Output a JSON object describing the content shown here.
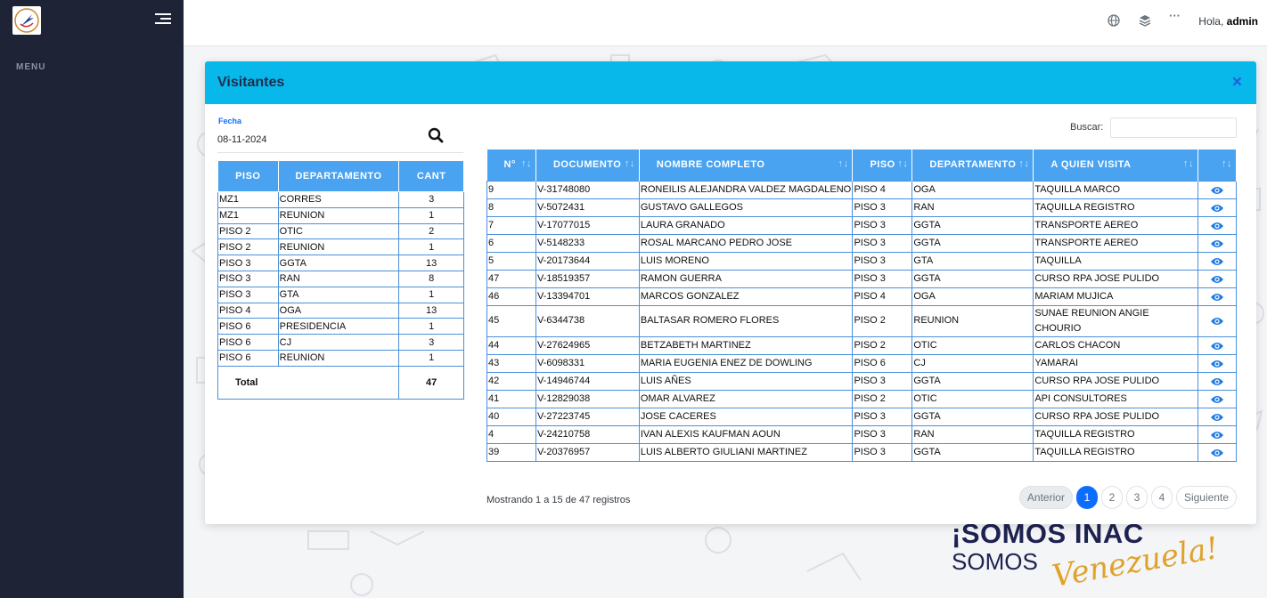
{
  "sidebar": {
    "menu_label": "MENU"
  },
  "topbar": {
    "greeting": "Hola,",
    "user": "admin",
    "icons": [
      "globe-icon",
      "layers-icon",
      "more-icon"
    ]
  },
  "brand": {
    "line1": "¡SOMOS INAC",
    "line2": "SOMOS",
    "script": "Venezuela!"
  },
  "modal": {
    "title": "Visitantes",
    "close_label": "×",
    "date_label": "Fecha",
    "date_value": "08-11-2024",
    "summary": {
      "headers": [
        "PISO",
        "DEPARTAMENTO",
        "CANT"
      ],
      "rows": [
        [
          "MZ1",
          "CORRES",
          "3"
        ],
        [
          "MZ1",
          "REUNION",
          "1"
        ],
        [
          "PISO 2",
          "OTIC",
          "2"
        ],
        [
          "PISO 2",
          "REUNION",
          "1"
        ],
        [
          "PISO 3",
          "GGTA",
          "13"
        ],
        [
          "PISO 3",
          "RAN",
          "8"
        ],
        [
          "PISO 3",
          "GTA",
          "1"
        ],
        [
          "PISO 4",
          "OGA",
          "13"
        ],
        [
          "PISO 6",
          "PRESIDENCIA",
          "1"
        ],
        [
          "PISO 6",
          "CJ",
          "3"
        ],
        [
          "PISO 6",
          "REUNION",
          "1"
        ]
      ],
      "total_label": "Total",
      "total_value": "47"
    },
    "search_label": "Buscar:",
    "search_value": "",
    "visitors": {
      "headers": [
        "N°",
        "DOCUMENTO",
        "NOMBRE COMPLETO",
        "PISO",
        "DEPARTAMENTO",
        "A QUIEN VISITA",
        ""
      ],
      "rows": [
        [
          "9",
          "V-31748080",
          "RONEILIS ALEJANDRA VALDEZ MAGDALENO",
          "PISO 4",
          "OGA",
          "TAQUILLA MARCO"
        ],
        [
          "8",
          "V-5072431",
          "GUSTAVO GALLEGOS",
          "PISO 3",
          "RAN",
          "TAQUILLA REGISTRO"
        ],
        [
          "7",
          "V-17077015",
          "LAURA GRANADO",
          "PISO 3",
          "GGTA",
          "TRANSPORTE AEREO"
        ],
        [
          "6",
          "V-5148233",
          "ROSAL MARCANO PEDRO JOSE",
          "PISO 3",
          "GGTA",
          "TRANSPORTE AEREO"
        ],
        [
          "5",
          "V-20173644",
          "LUIS MORENO",
          "PISO 3",
          "GTA",
          "TAQUILLA"
        ],
        [
          "47",
          "V-18519357",
          "RAMON GUERRA",
          "PISO 3",
          "GGTA",
          "CURSO RPA JOSE PULIDO"
        ],
        [
          "46",
          "V-13394701",
          "MARCOS GONZALEZ",
          "PISO 4",
          "OGA",
          "MARIAM MUJICA"
        ],
        [
          "45",
          "V-6344738",
          "BALTASAR ROMERO FLORES",
          "PISO 2",
          "REUNION",
          "SUNAE REUNION ANGIE CHOURIO"
        ],
        [
          "44",
          "V-27624965",
          "BETZABETH MARTINEZ",
          "PISO 2",
          "OTIC",
          "CARLOS CHACON"
        ],
        [
          "43",
          "V-6098331",
          "MARIA EUGENIA ENEZ DE DOWLING",
          "PISO 6",
          "CJ",
          "YAMARAI"
        ],
        [
          "42",
          "V-14946744",
          "LUIS AÑES",
          "PISO 3",
          "GGTA",
          "CURSO RPA JOSE PULIDO"
        ],
        [
          "41",
          "V-12829038",
          "OMAR ALVAREZ",
          "PISO 2",
          "OTIC",
          "API CONSULTORES"
        ],
        [
          "40",
          "V-27223745",
          "JOSE CACERES",
          "PISO 3",
          "GGTA",
          "CURSO RPA JOSE PULIDO"
        ],
        [
          "4",
          "V-24210758",
          "IVAN ALEXIS KAUFMAN AOUN",
          "PISO 3",
          "RAN",
          "TAQUILLA REGISTRO"
        ],
        [
          "39",
          "V-20376957",
          "LUIS ALBERTO GIULIANI MARTINEZ",
          "PISO 3",
          "GGTA",
          "TAQUILLA REGISTRO"
        ]
      ]
    },
    "info": "Mostrando 1 a 15 de 47 registros",
    "pagination": {
      "prev": "Anterior",
      "pages": [
        "1",
        "2",
        "3",
        "4"
      ],
      "active": "1",
      "next": "Siguiente"
    }
  },
  "colors": {
    "sidebar": "#1e2336",
    "modal_header": "#08b8ea",
    "table_header": "#4aa3f0",
    "accent": "#0d6efd"
  }
}
